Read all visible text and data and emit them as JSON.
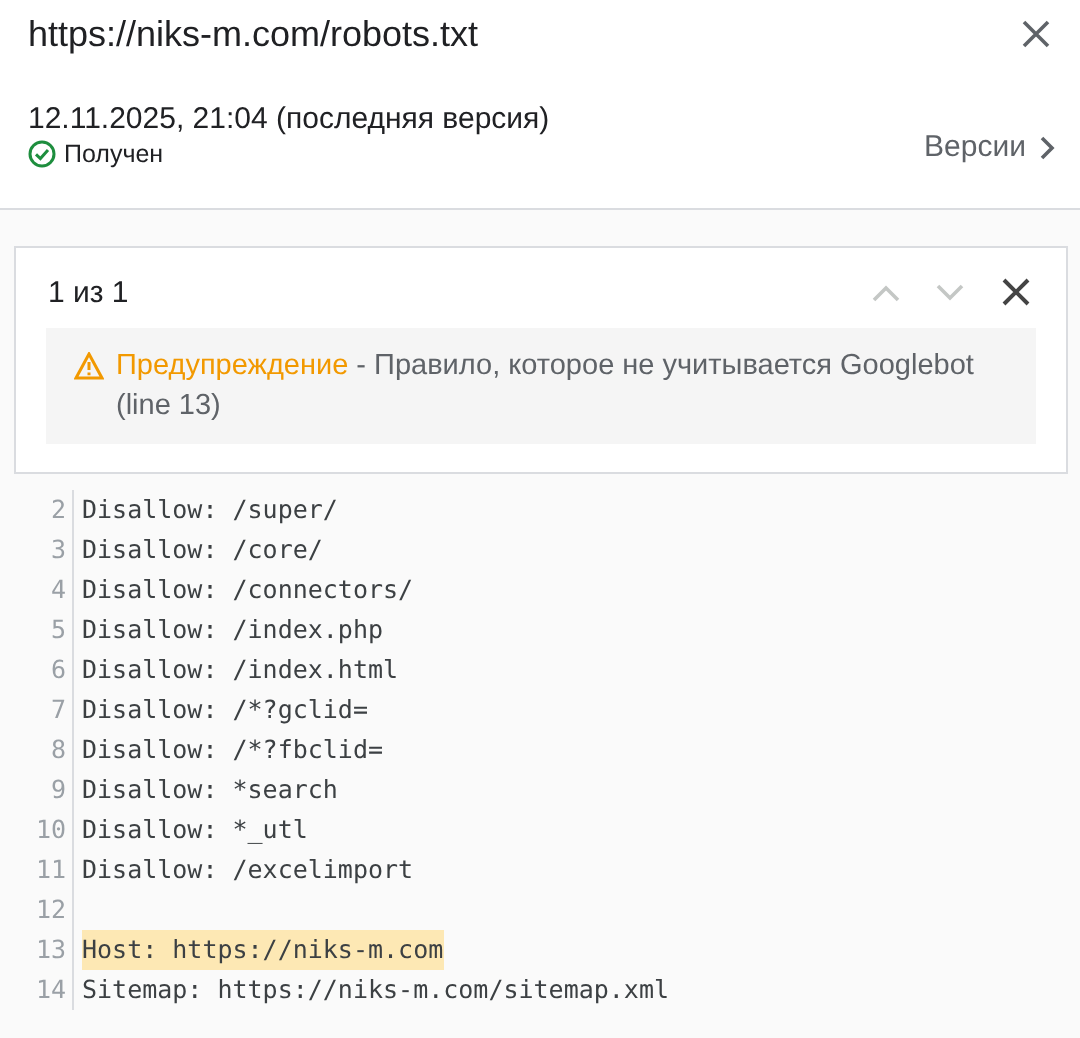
{
  "window": {
    "title": "https://niks-m.com/robots.txt"
  },
  "version": {
    "date": "12.11.2025, 21:04 (последняя версия)",
    "status": "Получен",
    "status_ok": true,
    "versions_link": "Версии"
  },
  "issues": {
    "counter": "1 из 1",
    "prev_disabled": true,
    "next_disabled": true,
    "warning": {
      "label": "Предупреждение",
      "text": " - Правило, которое не учитывается Googlebot (line 13)"
    }
  },
  "code_lines": [
    {
      "number": "2",
      "text": "Disallow: /super/",
      "highlighted": false
    },
    {
      "number": "3",
      "text": "Disallow: /core/",
      "highlighted": false
    },
    {
      "number": "4",
      "text": "Disallow: /connectors/",
      "highlighted": false
    },
    {
      "number": "5",
      "text": "Disallow: /index.php",
      "highlighted": false
    },
    {
      "number": "6",
      "text": "Disallow: /index.html",
      "highlighted": false
    },
    {
      "number": "7",
      "text": "Disallow: /*?gclid=",
      "highlighted": false
    },
    {
      "number": "8",
      "text": "Disallow: /*?fbclid=",
      "highlighted": false
    },
    {
      "number": "9",
      "text": "Disallow: *search",
      "highlighted": false
    },
    {
      "number": "10",
      "text": "Disallow: *_utl",
      "highlighted": false
    },
    {
      "number": "11",
      "text": "Disallow: /excelimport",
      "highlighted": false
    },
    {
      "number": "12",
      "highlighted": false
    },
    {
      "number": "13",
      "text": "Host: https://niks-m.com",
      "highlighted": true
    },
    {
      "number": "14",
      "text": "Sitemap: https://niks-m.com/sitemap.xml",
      "highlighted": false
    }
  ]
}
